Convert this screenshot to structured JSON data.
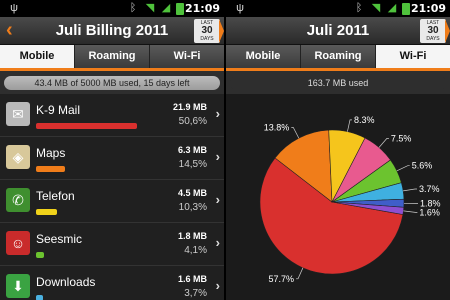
{
  "status": {
    "time": "21:09",
    "icons": [
      "usb-icon",
      "bluetooth-icon",
      "wifi-icon",
      "signal-icon",
      "battery-icon"
    ]
  },
  "left": {
    "title": "Juli Billing 2011",
    "badge": {
      "top": "LAST",
      "middle": "30",
      "bottom": "DAYS"
    },
    "tabs": [
      "Mobile",
      "Roaming",
      "Wi-Fi"
    ],
    "active_tab": "Mobile",
    "usage": "43.4 MB of 5000 MB used, 15 days left",
    "apps": [
      {
        "name": "K-9 Mail",
        "mb": "21.9 MB",
        "pct": "50,6%",
        "share": 0.506,
        "color": "#d9302e",
        "icon": "mail-icon"
      },
      {
        "name": "Maps",
        "mb": "6.3 MB",
        "pct": "14,5%",
        "share": 0.145,
        "color": "#f07d1a",
        "icon": "maps-icon"
      },
      {
        "name": "Telefon",
        "mb": "4.5 MB",
        "pct": "10,3%",
        "share": 0.103,
        "color": "#f0d21a",
        "icon": "phone-icon"
      },
      {
        "name": "Seesmic",
        "mb": "1.8 MB",
        "pct": "4,1%",
        "share": 0.041,
        "color": "#6cc32f",
        "icon": "seesmic-icon"
      },
      {
        "name": "Downloads",
        "mb": "1.6 MB",
        "pct": "3,7%",
        "share": 0.037,
        "color": "#4bb1e0",
        "icon": "download-icon"
      }
    ]
  },
  "right": {
    "title": "Juli 2011",
    "badge": {
      "top": "LAST",
      "middle": "30",
      "bottom": "DAYS"
    },
    "tabs": [
      "Mobile",
      "Roaming",
      "Wi-Fi"
    ],
    "active_tab": "Wi-Fi",
    "usage": "163.7 MB used"
  },
  "colors": {
    "accent": "#f07d1a"
  },
  "chart_data": {
    "type": "pie",
    "labels": [
      "57.7%",
      "13.8%",
      "8.3%",
      "7.5%",
      "5.6%",
      "3.7%",
      "1.8%",
      "1.6%"
    ],
    "values": [
      57.7,
      13.8,
      8.3,
      7.5,
      5.6,
      3.7,
      1.8,
      1.6
    ],
    "colors": [
      "#d9302e",
      "#f07d1a",
      "#f5c51c",
      "#e85a8f",
      "#6cc32f",
      "#3fb0e0",
      "#3f5ec9",
      "#8d4fd1"
    ]
  }
}
